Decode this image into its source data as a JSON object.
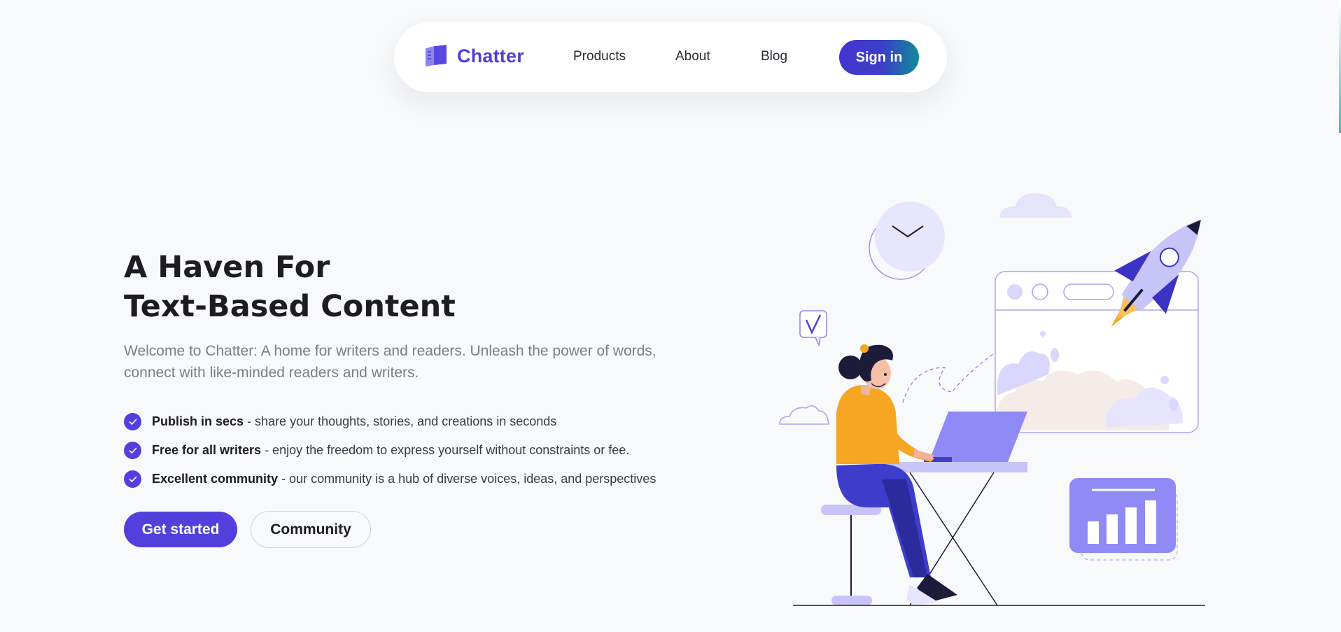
{
  "nav": {
    "brand": "Chatter",
    "links": [
      "Products",
      "About",
      "Blog"
    ],
    "signin_label": "Sign in"
  },
  "hero": {
    "title_line1": "A Haven For",
    "title_line2": "Text-Based Content",
    "subtitle_line1": "Welcome to Chatter: A home for writers and readers. Unleash the power of words,",
    "subtitle_line2": "connect with like-minded readers and writers.",
    "features": [
      {
        "title": "Publish in secs",
        "text": "- share your thoughts, stories, and creations in seconds"
      },
      {
        "title": "Free for all writers",
        "text": "- enjoy the freedom to express yourself without constraints or fee."
      },
      {
        "title": "Excellent community",
        "text": "- our community is a hub of diverse voices, ideas, and perspectives"
      }
    ],
    "primary_cta": "Get started",
    "secondary_cta": "Community"
  },
  "icons": {
    "logo": "book-icon",
    "check": "check-icon"
  },
  "colors": {
    "brand": "#5340dc",
    "background": "#f8f9fa",
    "illustration_light": "#c7c7f6",
    "illustration_accent": "#f6a623"
  }
}
